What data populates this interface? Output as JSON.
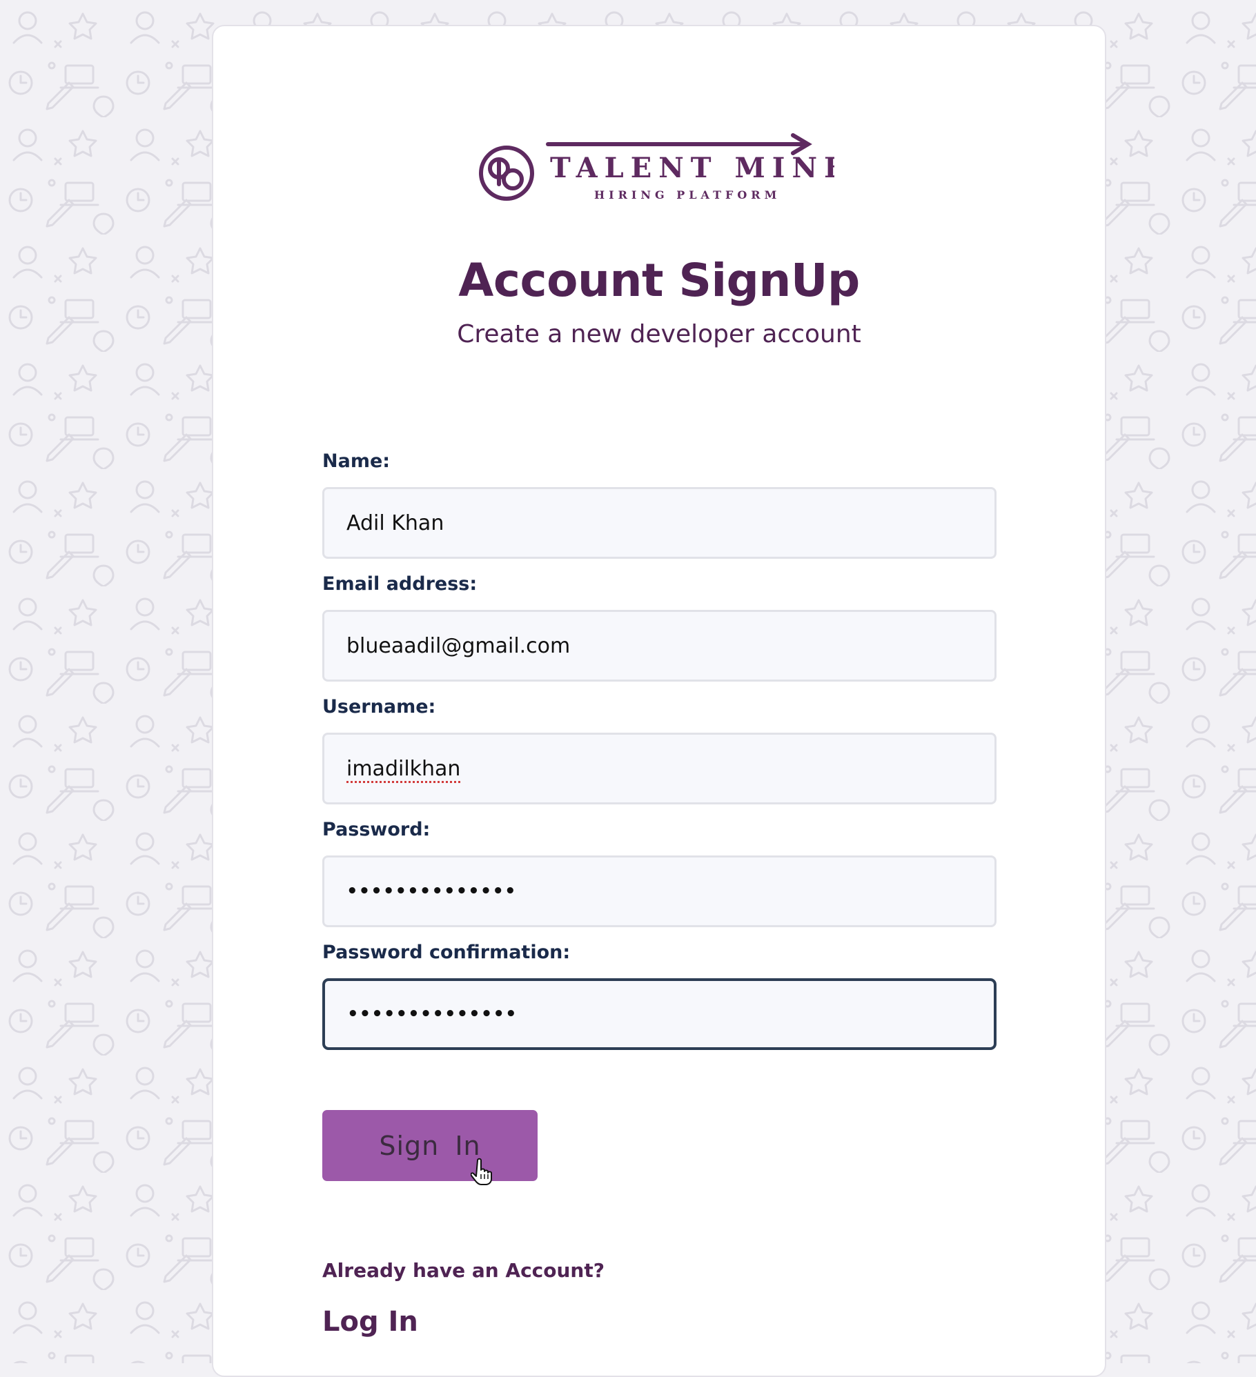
{
  "brand": {
    "name": "TALENT MINE",
    "tagline": "HIRING PLATFORM",
    "logo_color": "#5e2a60",
    "accent_color": "#9c59a9"
  },
  "header": {
    "title": "Account SignUp",
    "subtitle": "Create a new developer account"
  },
  "form": {
    "fields": [
      {
        "label": "Name:",
        "value": "Adil Khan"
      },
      {
        "label": "Email address:",
        "value": "blueaadil@gmail.com"
      },
      {
        "label": "Username:",
        "value": "imadilkhan"
      },
      {
        "label": "Password:",
        "value": "••••••••••••••"
      },
      {
        "label": "Password confirmation:",
        "value": "••••••••••••••"
      }
    ],
    "submit_label": "Sign In"
  },
  "footer": {
    "prompt": "Already have an Account?",
    "login_label": "Log In"
  },
  "icons": {
    "cursor": "hand-pointer-icon",
    "background": "doodle-pattern"
  }
}
